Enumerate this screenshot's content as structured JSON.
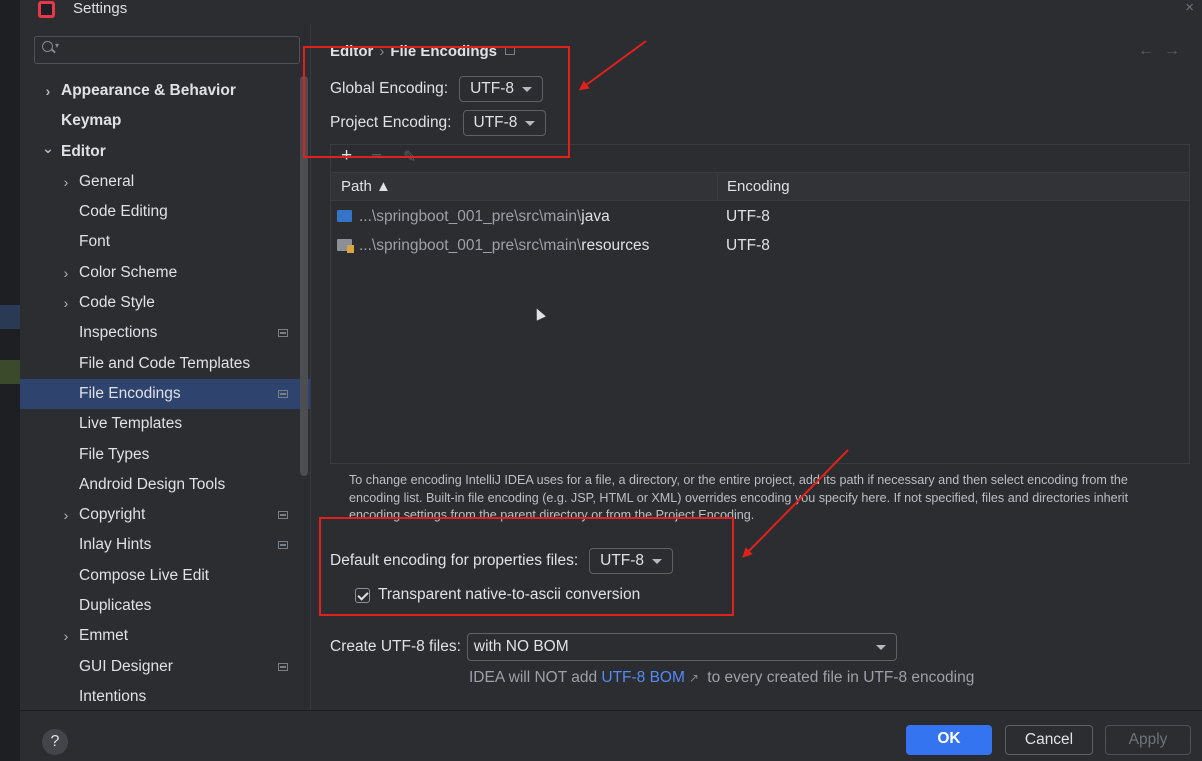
{
  "window": {
    "title": "Settings",
    "close_glyph": "×"
  },
  "search": {
    "placeholder": ""
  },
  "sidebar": {
    "items": [
      {
        "label": "Appearance & Behavior",
        "arrow": ">",
        "bold": true,
        "indent": 0,
        "proj": false,
        "selected": false
      },
      {
        "label": "Keymap",
        "arrow": "",
        "bold": true,
        "indent": 0,
        "proj": false,
        "selected": false
      },
      {
        "label": "Editor",
        "arrow": "v",
        "bold": true,
        "indent": 0,
        "proj": false,
        "selected": false
      },
      {
        "label": "General",
        "arrow": ">",
        "bold": false,
        "indent": 1,
        "proj": false,
        "selected": false
      },
      {
        "label": "Code Editing",
        "arrow": "",
        "bold": false,
        "indent": 1,
        "proj": false,
        "selected": false
      },
      {
        "label": "Font",
        "arrow": "",
        "bold": false,
        "indent": 1,
        "proj": false,
        "selected": false
      },
      {
        "label": "Color Scheme",
        "arrow": ">",
        "bold": false,
        "indent": 1,
        "proj": false,
        "selected": false
      },
      {
        "label": "Code Style",
        "arrow": ">",
        "bold": false,
        "indent": 1,
        "proj": false,
        "selected": false
      },
      {
        "label": "Inspections",
        "arrow": "",
        "bold": false,
        "indent": 1,
        "proj": true,
        "selected": false
      },
      {
        "label": "File and Code Templates",
        "arrow": "",
        "bold": false,
        "indent": 1,
        "proj": false,
        "selected": false
      },
      {
        "label": "File Encodings",
        "arrow": "",
        "bold": false,
        "indent": 1,
        "proj": true,
        "selected": true
      },
      {
        "label": "Live Templates",
        "arrow": "",
        "bold": false,
        "indent": 1,
        "proj": false,
        "selected": false
      },
      {
        "label": "File Types",
        "arrow": "",
        "bold": false,
        "indent": 1,
        "proj": false,
        "selected": false
      },
      {
        "label": "Android Design Tools",
        "arrow": "",
        "bold": false,
        "indent": 1,
        "proj": false,
        "selected": false
      },
      {
        "label": "Copyright",
        "arrow": ">",
        "bold": false,
        "indent": 1,
        "proj": true,
        "selected": false
      },
      {
        "label": "Inlay Hints",
        "arrow": "",
        "bold": false,
        "indent": 1,
        "proj": true,
        "selected": false
      },
      {
        "label": "Compose Live Edit",
        "arrow": "",
        "bold": false,
        "indent": 1,
        "proj": false,
        "selected": false
      },
      {
        "label": "Duplicates",
        "arrow": "",
        "bold": false,
        "indent": 1,
        "proj": false,
        "selected": false
      },
      {
        "label": "Emmet",
        "arrow": ">",
        "bold": false,
        "indent": 1,
        "proj": false,
        "selected": false
      },
      {
        "label": "GUI Designer",
        "arrow": "",
        "bold": false,
        "indent": 1,
        "proj": true,
        "selected": false
      },
      {
        "label": "Intentions",
        "arrow": "",
        "bold": false,
        "indent": 1,
        "proj": false,
        "selected": false
      }
    ]
  },
  "breadcrumb": {
    "parent": "Editor",
    "separator": "›",
    "current": "File Encodings"
  },
  "nav": {
    "back": "←",
    "forward": "→"
  },
  "global_encoding": {
    "label": "Global Encoding:",
    "value": "UTF-8"
  },
  "project_encoding": {
    "label": "Project Encoding:",
    "value": "UTF-8"
  },
  "toolbar": {
    "add": "+",
    "remove": "−",
    "edit": "✎"
  },
  "table": {
    "columns": {
      "path": "Path ▲",
      "encoding": "Encoding"
    },
    "rows": [
      {
        "path_prefix": "...\\springboot_001_pre\\src\\main\\",
        "path_leaf": "java",
        "encoding": "UTF-8",
        "icon": "source-folder-icon"
      },
      {
        "path_prefix": "...\\springboot_001_pre\\src\\main\\",
        "path_leaf": "resources",
        "encoding": "UTF-8",
        "icon": "resources-folder-icon"
      }
    ]
  },
  "help_text": "To change encoding IntelliJ IDEA uses for a file, a directory, or the entire project, add its path if necessary and then select encoding from the encoding list. Built-in file encoding (e.g. JSP, HTML or XML) overrides encoding you specify here. If not specified, files and directories inherit encoding settings from the parent directory or from the Project Encoding.",
  "properties_encoding": {
    "label": "Default encoding for properties files:",
    "value": "UTF-8"
  },
  "native_to_ascii": {
    "label": "Transparent native-to-ascii conversion",
    "checked": true
  },
  "create_utf8": {
    "label": "Create UTF-8 files:",
    "value": "with NO BOM"
  },
  "bom_note": {
    "before": "IDEA will NOT add ",
    "link": "UTF-8 BOM",
    "ext": "↗",
    "after": " to every created file in UTF-8 encoding"
  },
  "buttons": {
    "help": "?",
    "ok": "OK",
    "cancel": "Cancel",
    "apply": "Apply"
  },
  "colors": {
    "accent": "#3574f0",
    "selection": "#2e436e",
    "annotation": "#e0211c",
    "link": "#548af7"
  }
}
